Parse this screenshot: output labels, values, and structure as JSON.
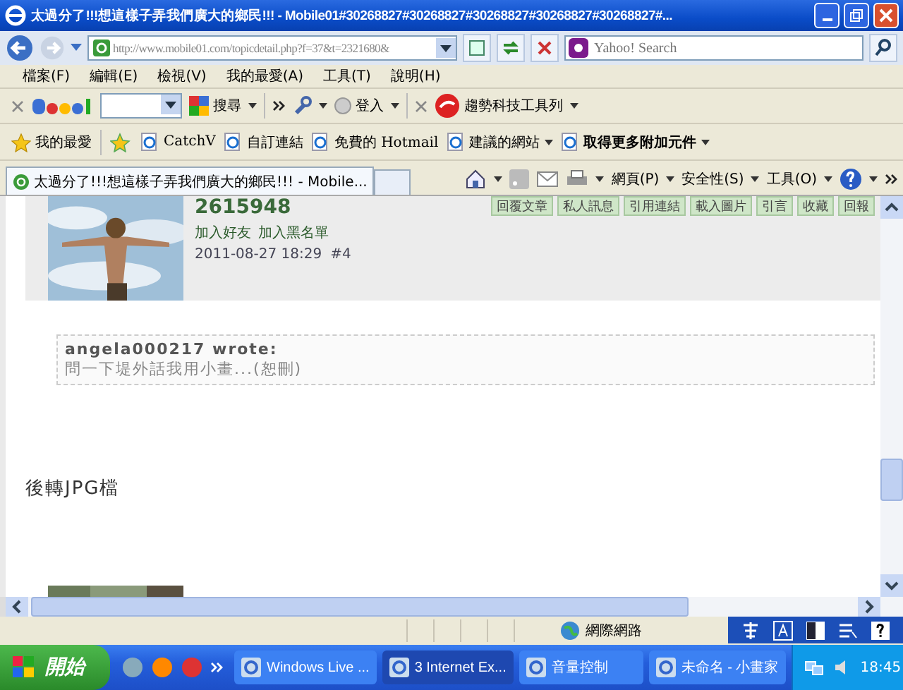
{
  "window": {
    "title": "太過分了!!!想這樣子弄我們廣大的鄉民!!! - Mobile01#30268827#30268827#30268827#30268827#30268827#..."
  },
  "address_bar": {
    "url": "http://www.mobile01.com/topicdetail.php?f=37&t=2321680&",
    "search_placeholder": "Yahoo! Search"
  },
  "menu": [
    "檔案(F)",
    "編輯(E)",
    "檢視(V)",
    "我的最愛(A)",
    "工具(T)",
    "說明(H)"
  ],
  "google_toolbar": {
    "search": "搜尋",
    "login": "登入",
    "trend": "趨勢科技工具列"
  },
  "favorites": {
    "label": "我的最愛",
    "links": [
      {
        "label": "CatchV",
        "dropdown": false,
        "bold": false
      },
      {
        "label": "自訂連結",
        "dropdown": false,
        "bold": false
      },
      {
        "label": "免費的 Hotmail",
        "dropdown": false,
        "bold": false
      },
      {
        "label": "建議的網站",
        "dropdown": true,
        "bold": false
      },
      {
        "label": "取得更多附加元件",
        "dropdown": true,
        "bold": true
      }
    ]
  },
  "tabs": [
    {
      "label": "太過分了!!!想這樣子弄我們廣大的鄉民!!! - Mobile...",
      "selected": true
    }
  ],
  "command_bar": [
    "網頁(P)",
    "安全性(S)",
    "工具(O)"
  ],
  "post": {
    "username": "2615948",
    "actions": [
      "回覆文章",
      "私人訊息",
      "引用連結",
      "載入圖片",
      "引言",
      "收藏",
      "回報"
    ],
    "links": [
      "加入好友",
      "加入黑名單"
    ],
    "timestamp": "2011-08-27 18:29",
    "number": "#4",
    "quote": {
      "author": "angela000217 wrote:",
      "text": "問一下堤外話我用小畫...(恕刪)"
    },
    "body": "後轉JPG檔"
  },
  "status_bar": {
    "zone": "網際網路"
  },
  "taskbar": {
    "start": "開始",
    "tasks": [
      {
        "label": "Windows Live ...",
        "selected": false
      },
      {
        "label": "3 Internet Ex...",
        "selected": true
      },
      {
        "label": "音量控制",
        "selected": false
      },
      {
        "label": "未命名 - 小畫家",
        "selected": false
      }
    ],
    "clock": "18:45"
  }
}
